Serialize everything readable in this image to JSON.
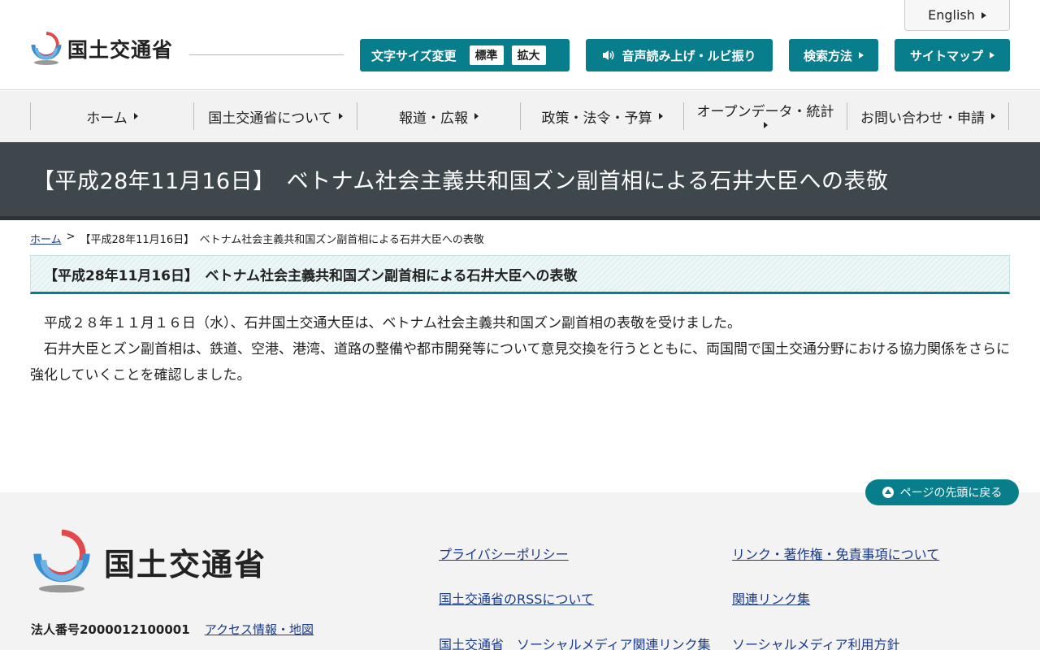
{
  "header": {
    "logo_text": "国土交通省",
    "english_label": "English",
    "font_size": {
      "label": "文字サイズ変更",
      "standard": "標準",
      "large": "拡大"
    },
    "voice_label": "音声読み上げ・ルビ振り",
    "search_label": "検索方法",
    "sitemap_label": "サイトマップ"
  },
  "gnav": {
    "items": [
      {
        "label": "ホーム"
      },
      {
        "label": "国土交通省について"
      },
      {
        "label": "報道・広報"
      },
      {
        "label": "政策・法令・予算"
      },
      {
        "label": "オープンデータ・統計"
      },
      {
        "label": "お問い合わせ・申請"
      }
    ]
  },
  "page": {
    "title": "【平成28年11月16日】　ベトナム社会主義共和国ズン副首相による石井大臣への表敬",
    "breadcrumb_home": "ホーム",
    "breadcrumb_sep": ">",
    "breadcrumb_current": "【平成28年11月16日】　ベトナム社会主義共和国ズン副首相による石井大臣への表敬",
    "section_heading": "【平成28年11月16日】　ベトナム社会主義共和国ズン副首相による石井大臣への表敬",
    "paragraphs": [
      "平成２８年１１月１６日（水）、石井国土交通大臣は、ベトナム社会主義共和国ズン副首相の表敬を受けました。",
      "石井大臣とズン副首相は、鉄道、空港、港湾、道路の整備や都市開発等について意見交換を行うとともに、両国間で国土交通分野における協力関係をさらに強化していくことを確認しました。"
    ]
  },
  "footer": {
    "pagetop_label": "ページの先頭に戻る",
    "logo_text": "国土交通省",
    "corp_number": "法人番号2000012100001",
    "access_label": "アクセス情報・地図",
    "links": {
      "privacy": "プライバシーポリシー",
      "rss": "国土交通省のRSSについて",
      "social_links": "国土交通省　ソーシャルメディア関連リンク集",
      "copyright": "リンク・著作権・免責事項について",
      "related": "関連リンク集",
      "social_policy": "ソーシャルメディア利用方針"
    }
  },
  "colors": {
    "accent": "#087d8c",
    "banner": "#3e474c",
    "link": "#1a3a8a"
  }
}
